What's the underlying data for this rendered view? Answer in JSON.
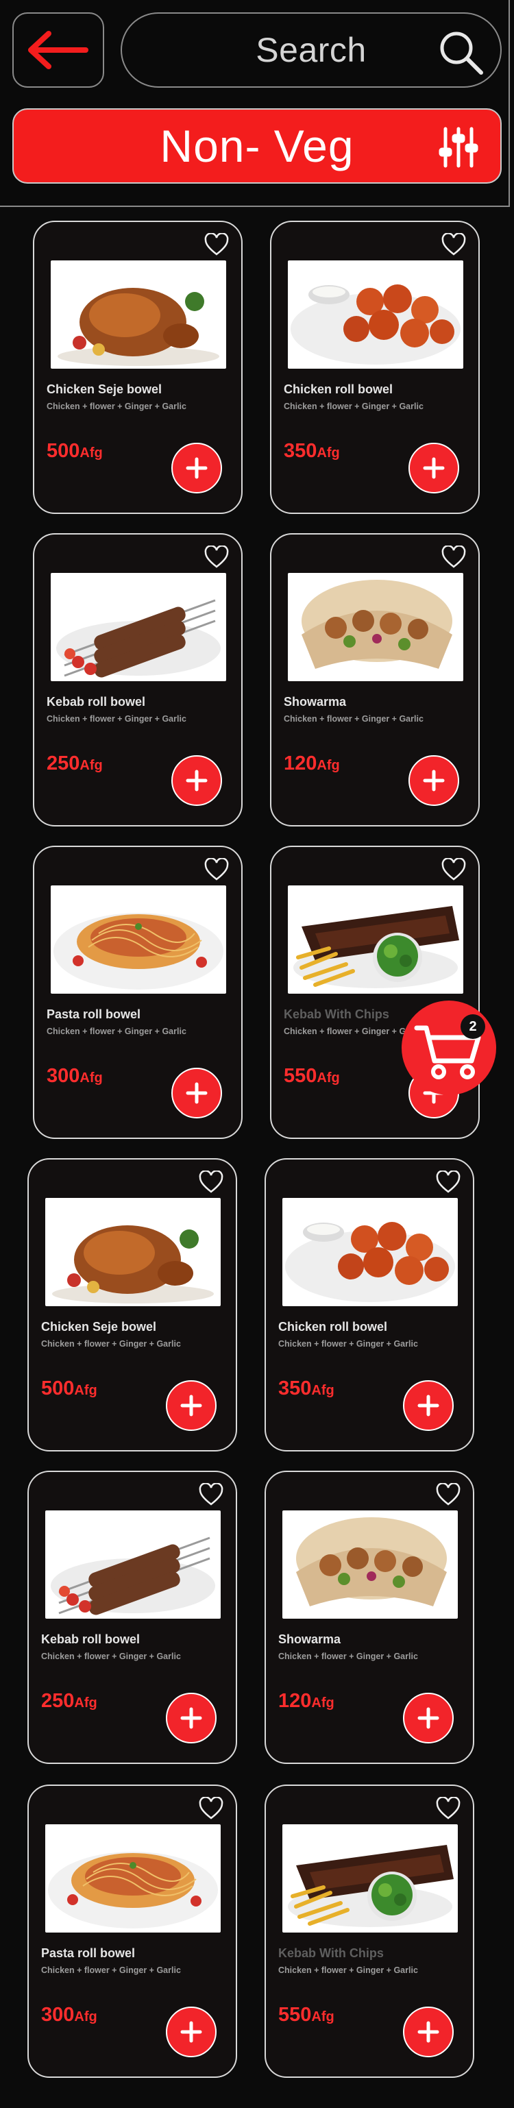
{
  "header": {
    "search_label": "Search",
    "category_label": "Non- Veg",
    "icons": [
      "back-arrow-icon",
      "search-icon",
      "filter-sliders-icon"
    ]
  },
  "colors": {
    "accent": "#f31d1d",
    "background": "#0b0b0b",
    "card": "#120f0f",
    "price": "#ff2d2d"
  },
  "items": [
    {
      "name": "Chicken Seje bowel",
      "ingredients": "Chicken + flower + Ginger + Garlic",
      "price": "500",
      "currency": "Afg",
      "image": "roast-chicken"
    },
    {
      "name": "Chicken roll bowel",
      "ingredients": "Chicken + flower + Ginger + Garlic",
      "price": "350",
      "currency": "Afg",
      "image": "fried-chicken"
    },
    {
      "name": "Kebab roll bowel",
      "ingredients": "Chicken + flower + Ginger + Garlic",
      "price": "250",
      "currency": "Afg",
      "image": "kebab-skewers"
    },
    {
      "name": "Showarma",
      "ingredients": "Chicken + flower + Ginger + Garlic",
      "price": "120",
      "currency": "Afg",
      "image": "shawarma"
    },
    {
      "name": "Pasta roll bowel",
      "ingredients": "Chicken + flower + Ginger + Garlic",
      "price": "300",
      "currency": "Afg",
      "image": "pasta"
    },
    {
      "name": "Kebab With Chips",
      "ingredients": "Chicken + flower + Ginger + Garlic",
      "price": "550",
      "currency": "Afg",
      "image": "ribs-chips"
    },
    {
      "name": "Chicken Seje bowel",
      "ingredients": "Chicken + flower + Ginger + Garlic",
      "price": "500",
      "currency": "Afg",
      "image": "roast-chicken"
    },
    {
      "name": "Chicken roll bowel",
      "ingredients": "Chicken + flower + Ginger + Garlic",
      "price": "350",
      "currency": "Afg",
      "image": "fried-chicken"
    },
    {
      "name": "Kebab roll bowel",
      "ingredients": "Chicken + flower + Ginger + Garlic",
      "price": "250",
      "currency": "Afg",
      "image": "kebab-skewers"
    },
    {
      "name": "Showarma",
      "ingredients": "Chicken + flower + Ginger + Garlic",
      "price": "120",
      "currency": "Afg",
      "image": "shawarma"
    },
    {
      "name": "Pasta roll bowel",
      "ingredients": "Chicken + flower + Ginger + Garlic",
      "price": "300",
      "currency": "Afg",
      "image": "pasta"
    },
    {
      "name": "Kebab With Chips",
      "ingredients": "Chicken + flower + Ginger + Garlic",
      "price": "550",
      "currency": "Afg",
      "image": "ribs-chips"
    }
  ],
  "cart": {
    "count": "2",
    "icon": "shopping-cart-icon"
  }
}
